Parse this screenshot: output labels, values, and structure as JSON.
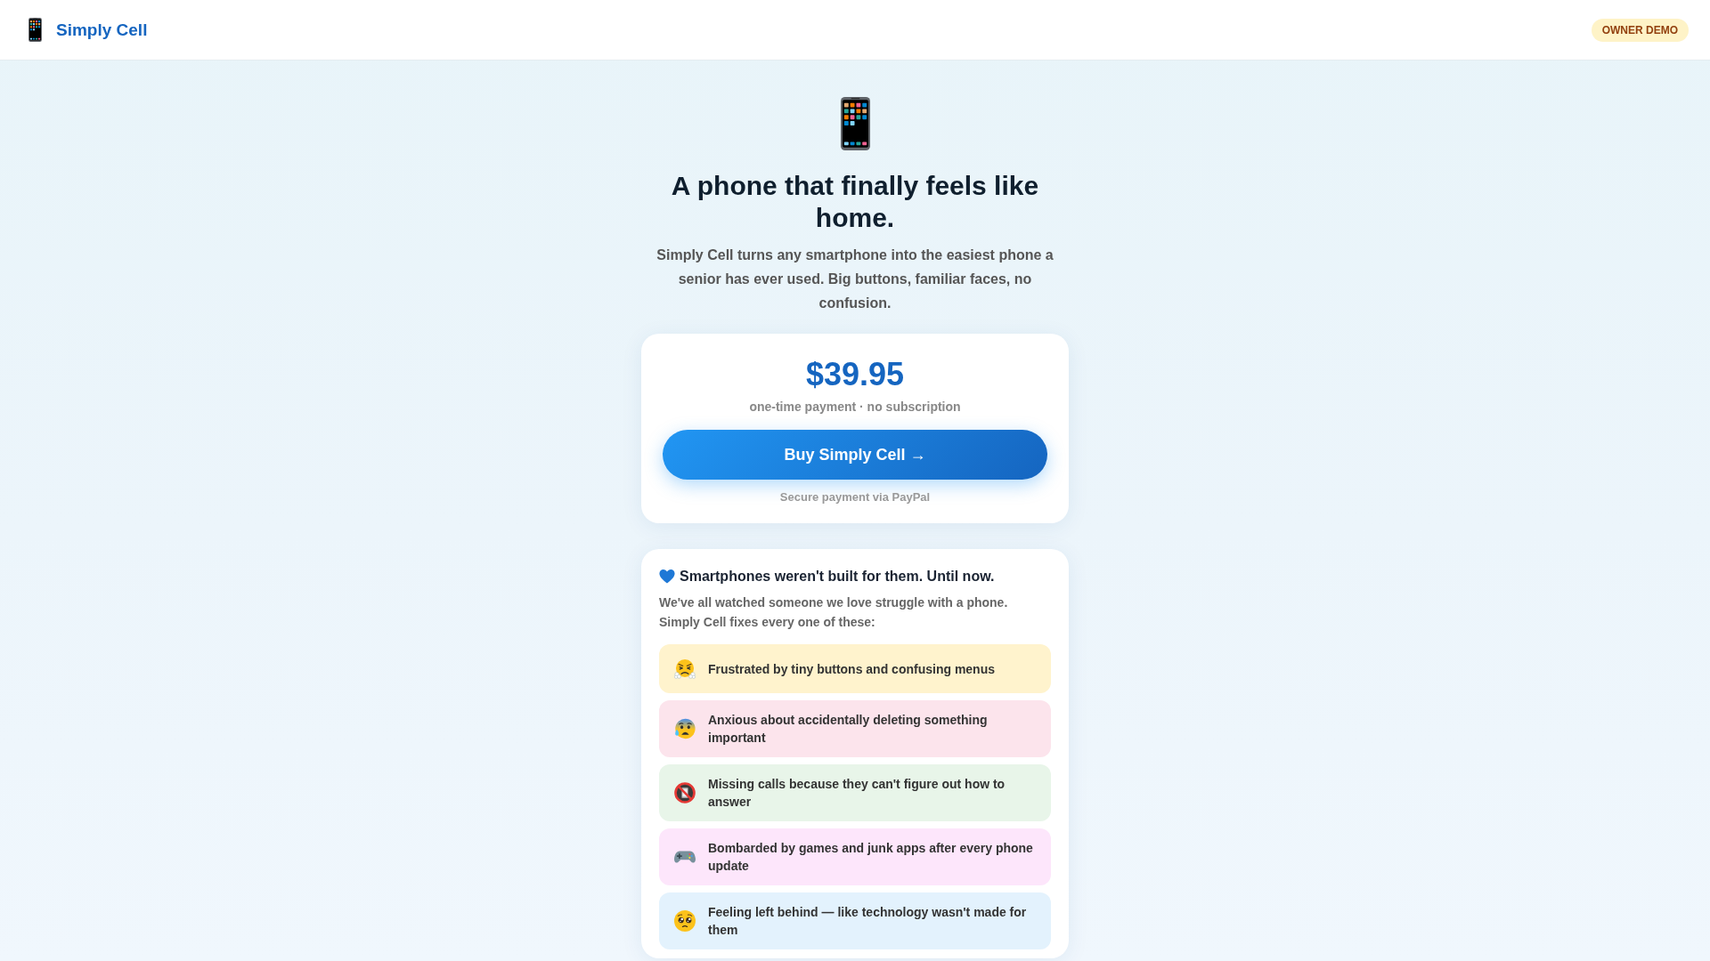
{
  "top_bar": {
    "brand": "Simply Cell",
    "badge": "OWNER DEMO"
  },
  "hero": {
    "title": "A phone that finally feels like home.",
    "subtitle": "Simply Cell turns any smartphone into the easiest phone a senior has ever used. Big buttons, familiar faces, no confusion."
  },
  "price_card": {
    "price": "$39.95",
    "terms": "one-time payment · no subscription",
    "buy_button": "Buy Simply Cell →",
    "note": "Secure payment via PayPal"
  },
  "pain_card": {
    "title": "Smartphones weren't built for them. Until now.",
    "intro": "We've all watched someone we love struggle with a phone. Simply Cell fixes every one of these:",
    "items": [
      {
        "text": "Frustrated by tiny buttons and confusing menus",
        "color": "#fff3cd"
      },
      {
        "text": "Anxious about accidentally deleting something important",
        "color": "#fce4ec"
      },
      {
        "text": "Missing calls because they can't figure out how to answer",
        "color": "#e8f5e9"
      },
      {
        "text": "Bombarded by games and junk apps after every phone update",
        "color": "#fde6fb"
      },
      {
        "text": "Feeling left behind — like technology wasn't made for them",
        "color": "#e3f2fd"
      }
    ]
  }
}
